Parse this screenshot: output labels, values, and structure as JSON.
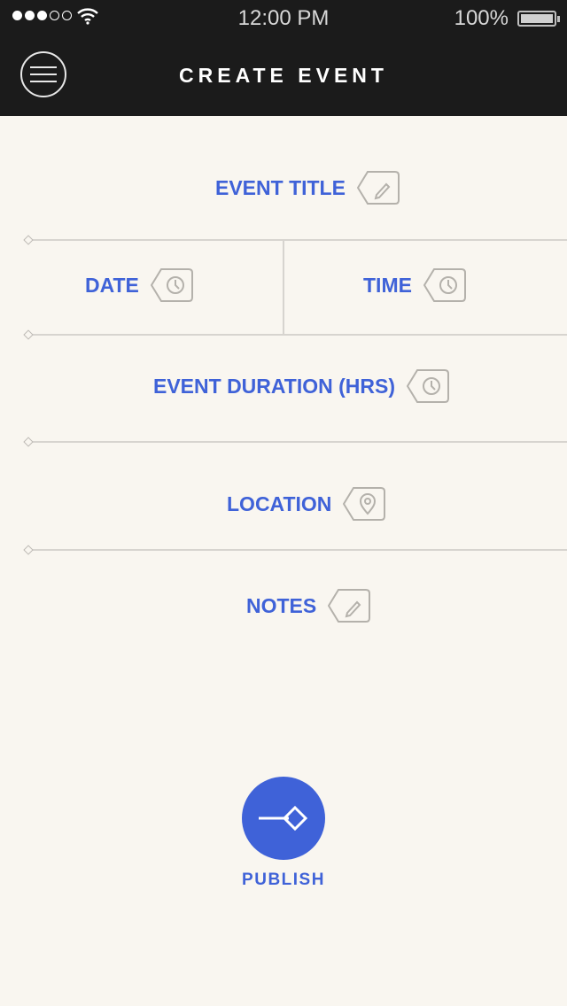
{
  "status_bar": {
    "time": "12:00 PM",
    "battery": "100%",
    "signal_icon": "signal-dots-icon",
    "wifi_icon": "wifi-icon",
    "battery_icon": "battery-icon"
  },
  "header": {
    "title": "CREATE EVENT",
    "menu_icon": "hamburger-menu-icon"
  },
  "form": {
    "event_title": {
      "label": "EVENT TITLE",
      "icon": "pencil-icon"
    },
    "date": {
      "label": "DATE",
      "icon": "clock-icon"
    },
    "time": {
      "label": "TIME",
      "icon": "clock-icon"
    },
    "duration": {
      "label": "EVENT DURATION (HRS)",
      "icon": "clock-icon"
    },
    "location": {
      "label": "LOCATION",
      "icon": "map-pin-icon"
    },
    "notes": {
      "label": "NOTES",
      "icon": "pencil-icon"
    }
  },
  "publish": {
    "label": "PUBLISH",
    "icon": "publish-arrow-icon"
  },
  "colors": {
    "accent": "#3f62d8",
    "header_bg": "#1b1b1b",
    "page_bg": "#f9f6f0",
    "divider": "#d7d4cf",
    "icon_stroke": "#b4b1ab"
  }
}
